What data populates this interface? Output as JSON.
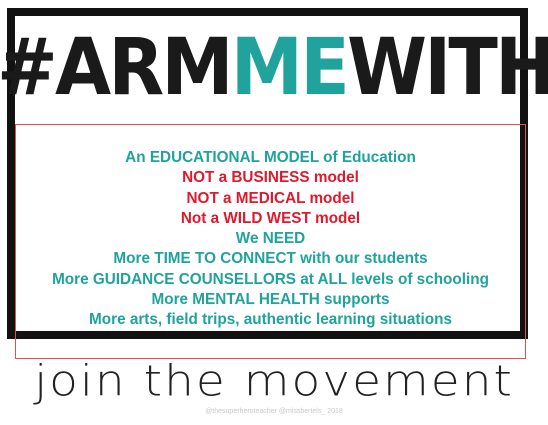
{
  "headline": {
    "hash": "#",
    "word1": "ARM",
    "word2": "ME",
    "word3": "WITH"
  },
  "lines": [
    {
      "text": "An EDUCATIONAL MODEL of Education",
      "color": "#1fa39c"
    },
    {
      "text": "NOT a BUSINESS model",
      "color": "#e0192c"
    },
    {
      "text": "NOT a MEDICAL model",
      "color": "#e0192c"
    },
    {
      "text": "Not a WILD WEST model",
      "color": "#e0192c"
    },
    {
      "text": "We NEED",
      "color": "#1fa39c"
    },
    {
      "text": "More TIME TO CONNECT with our students",
      "color": "#1fa39c"
    },
    {
      "text": "More GUIDANCE COUNSELLORS at ALL levels of schooling",
      "color": "#1fa39c"
    },
    {
      "text": "More MENTAL HEALTH supports",
      "color": "#1fa39c"
    },
    {
      "text": "More arts, field trips, authentic learning situations",
      "color": "#1fa39c"
    }
  ],
  "tagline": "join the movement",
  "credit": "@thesuperheroteacher @missbertels_ 2018",
  "colors": {
    "accent_teal": "#1fa39c",
    "accent_red": "#e0192c",
    "frame": "#111111"
  }
}
